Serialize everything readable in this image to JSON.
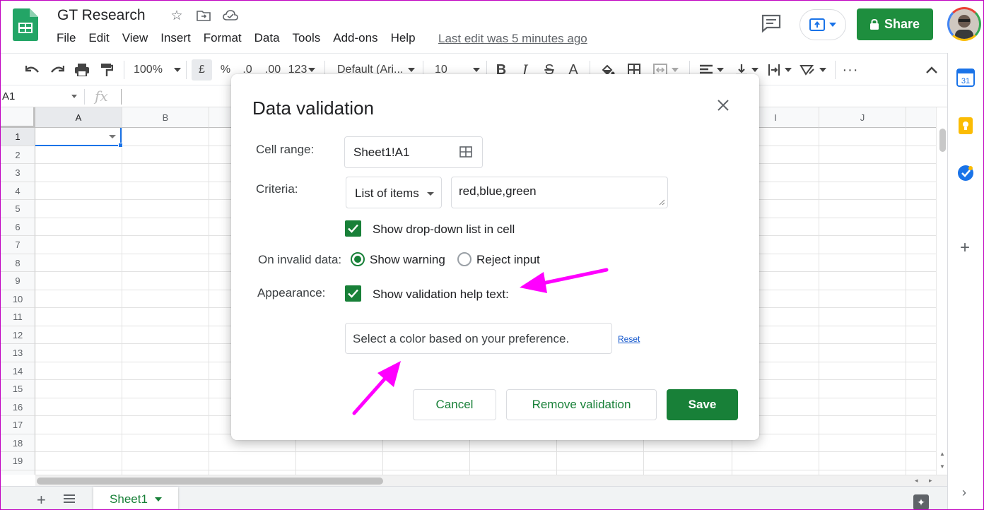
{
  "header": {
    "doc_title": "GT Research",
    "menus": [
      "File",
      "Edit",
      "View",
      "Insert",
      "Format",
      "Data",
      "Tools",
      "Add-ons",
      "Help"
    ],
    "last_edit": "Last edit was 5 minutes ago",
    "share_label": "Share"
  },
  "toolbar": {
    "zoom": "100%",
    "currency": "£",
    "percent": "%",
    "decrease_decimals": ".0",
    "increase_decimals": ".00",
    "more_formats": "123",
    "font": "Default (Ari...",
    "font_size": "10"
  },
  "formula_bar": {
    "name_box": "A1",
    "fx": "fx"
  },
  "grid": {
    "columns": [
      "A",
      "B",
      "I",
      "J"
    ],
    "rows": [
      "1",
      "2",
      "3",
      "4",
      "5",
      "6",
      "7",
      "8",
      "9",
      "10",
      "11",
      "12",
      "13",
      "14",
      "15",
      "16",
      "17",
      "18",
      "19"
    ]
  },
  "sheet_tabs": {
    "active": "Sheet1"
  },
  "dialog": {
    "title": "Data validation",
    "cell_range_label": "Cell range:",
    "cell_range_value": "Sheet1!A1",
    "criteria_label": "Criteria:",
    "criteria_type": "List of items",
    "criteria_value": "red,blue,green",
    "show_dropdown_label": "Show drop-down list in cell",
    "show_dropdown_checked": true,
    "invalid_label": "On invalid data:",
    "show_warning_label": "Show warning",
    "reject_input_label": "Reject input",
    "invalid_selected": "Show warning",
    "appearance_label": "Appearance:",
    "help_text_label": "Show validation help text:",
    "help_text_checked": true,
    "help_text_value": "Select a color based on your preference.",
    "reset_label": "Reset",
    "cancel_label": "Cancel",
    "remove_label": "Remove validation",
    "save_label": "Save"
  },
  "colors": {
    "primary_green": "#188038",
    "annotation_magenta": "#ff00ff",
    "selection_blue": "#1a73e8"
  }
}
